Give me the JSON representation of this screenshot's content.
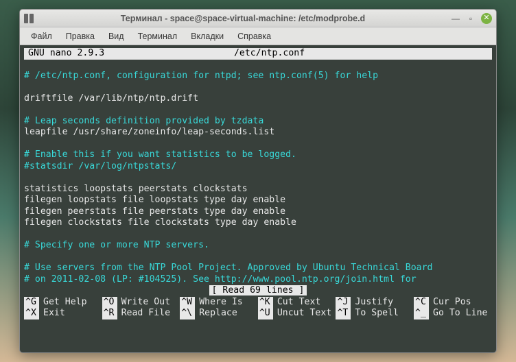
{
  "window": {
    "title": "Терминал - space@space-virtual-machine: /etc/modprobe.d"
  },
  "menu": {
    "items": [
      "Файл",
      "Правка",
      "Вид",
      "Терминал",
      "Вкладки",
      "Справка"
    ]
  },
  "nano": {
    "version": "GNU nano 2.9.3",
    "filename": "/etc/ntp.conf",
    "read_status": "[ Read 69 lines ]"
  },
  "content": [
    {
      "text": "# /etc/ntp.conf, configuration for ntpd; see ntp.conf(5) for help",
      "cls": "comment"
    },
    {
      "text": "",
      "cls": ""
    },
    {
      "text": "driftfile /var/lib/ntp/ntp.drift",
      "cls": ""
    },
    {
      "text": "",
      "cls": ""
    },
    {
      "text": "# Leap seconds definition provided by tzdata",
      "cls": "comment"
    },
    {
      "text": "leapfile /usr/share/zoneinfo/leap-seconds.list",
      "cls": ""
    },
    {
      "text": "",
      "cls": ""
    },
    {
      "text": "# Enable this if you want statistics to be logged.",
      "cls": "comment"
    },
    {
      "text": "#statsdir /var/log/ntpstats/",
      "cls": "comment"
    },
    {
      "text": "",
      "cls": ""
    },
    {
      "text": "statistics loopstats peerstats clockstats",
      "cls": ""
    },
    {
      "text": "filegen loopstats file loopstats type day enable",
      "cls": ""
    },
    {
      "text": "filegen peerstats file peerstats type day enable",
      "cls": ""
    },
    {
      "text": "filegen clockstats file clockstats type day enable",
      "cls": ""
    },
    {
      "text": "",
      "cls": ""
    },
    {
      "text": "# Specify one or more NTP servers.",
      "cls": "comment"
    },
    {
      "text": "",
      "cls": ""
    },
    {
      "text": "# Use servers from the NTP Pool Project. Approved by Ubuntu Technical Board",
      "cls": "comment"
    },
    {
      "text": "# on 2011-02-08 (LP: #104525). See http://www.pool.ntp.org/join.html for",
      "cls": "comment"
    }
  ],
  "shortcuts": {
    "row1": [
      {
        "key": "^G",
        "label": "Get Help"
      },
      {
        "key": "^O",
        "label": "Write Out"
      },
      {
        "key": "^W",
        "label": "Where Is"
      },
      {
        "key": "^K",
        "label": "Cut Text"
      },
      {
        "key": "^J",
        "label": "Justify"
      },
      {
        "key": "^C",
        "label": "Cur Pos"
      }
    ],
    "row2": [
      {
        "key": "^X",
        "label": "Exit"
      },
      {
        "key": "^R",
        "label": "Read File"
      },
      {
        "key": "^\\",
        "label": "Replace"
      },
      {
        "key": "^U",
        "label": "Uncut Text"
      },
      {
        "key": "^T",
        "label": "To Spell"
      },
      {
        "key": "^_",
        "label": "Go To Line"
      }
    ]
  }
}
